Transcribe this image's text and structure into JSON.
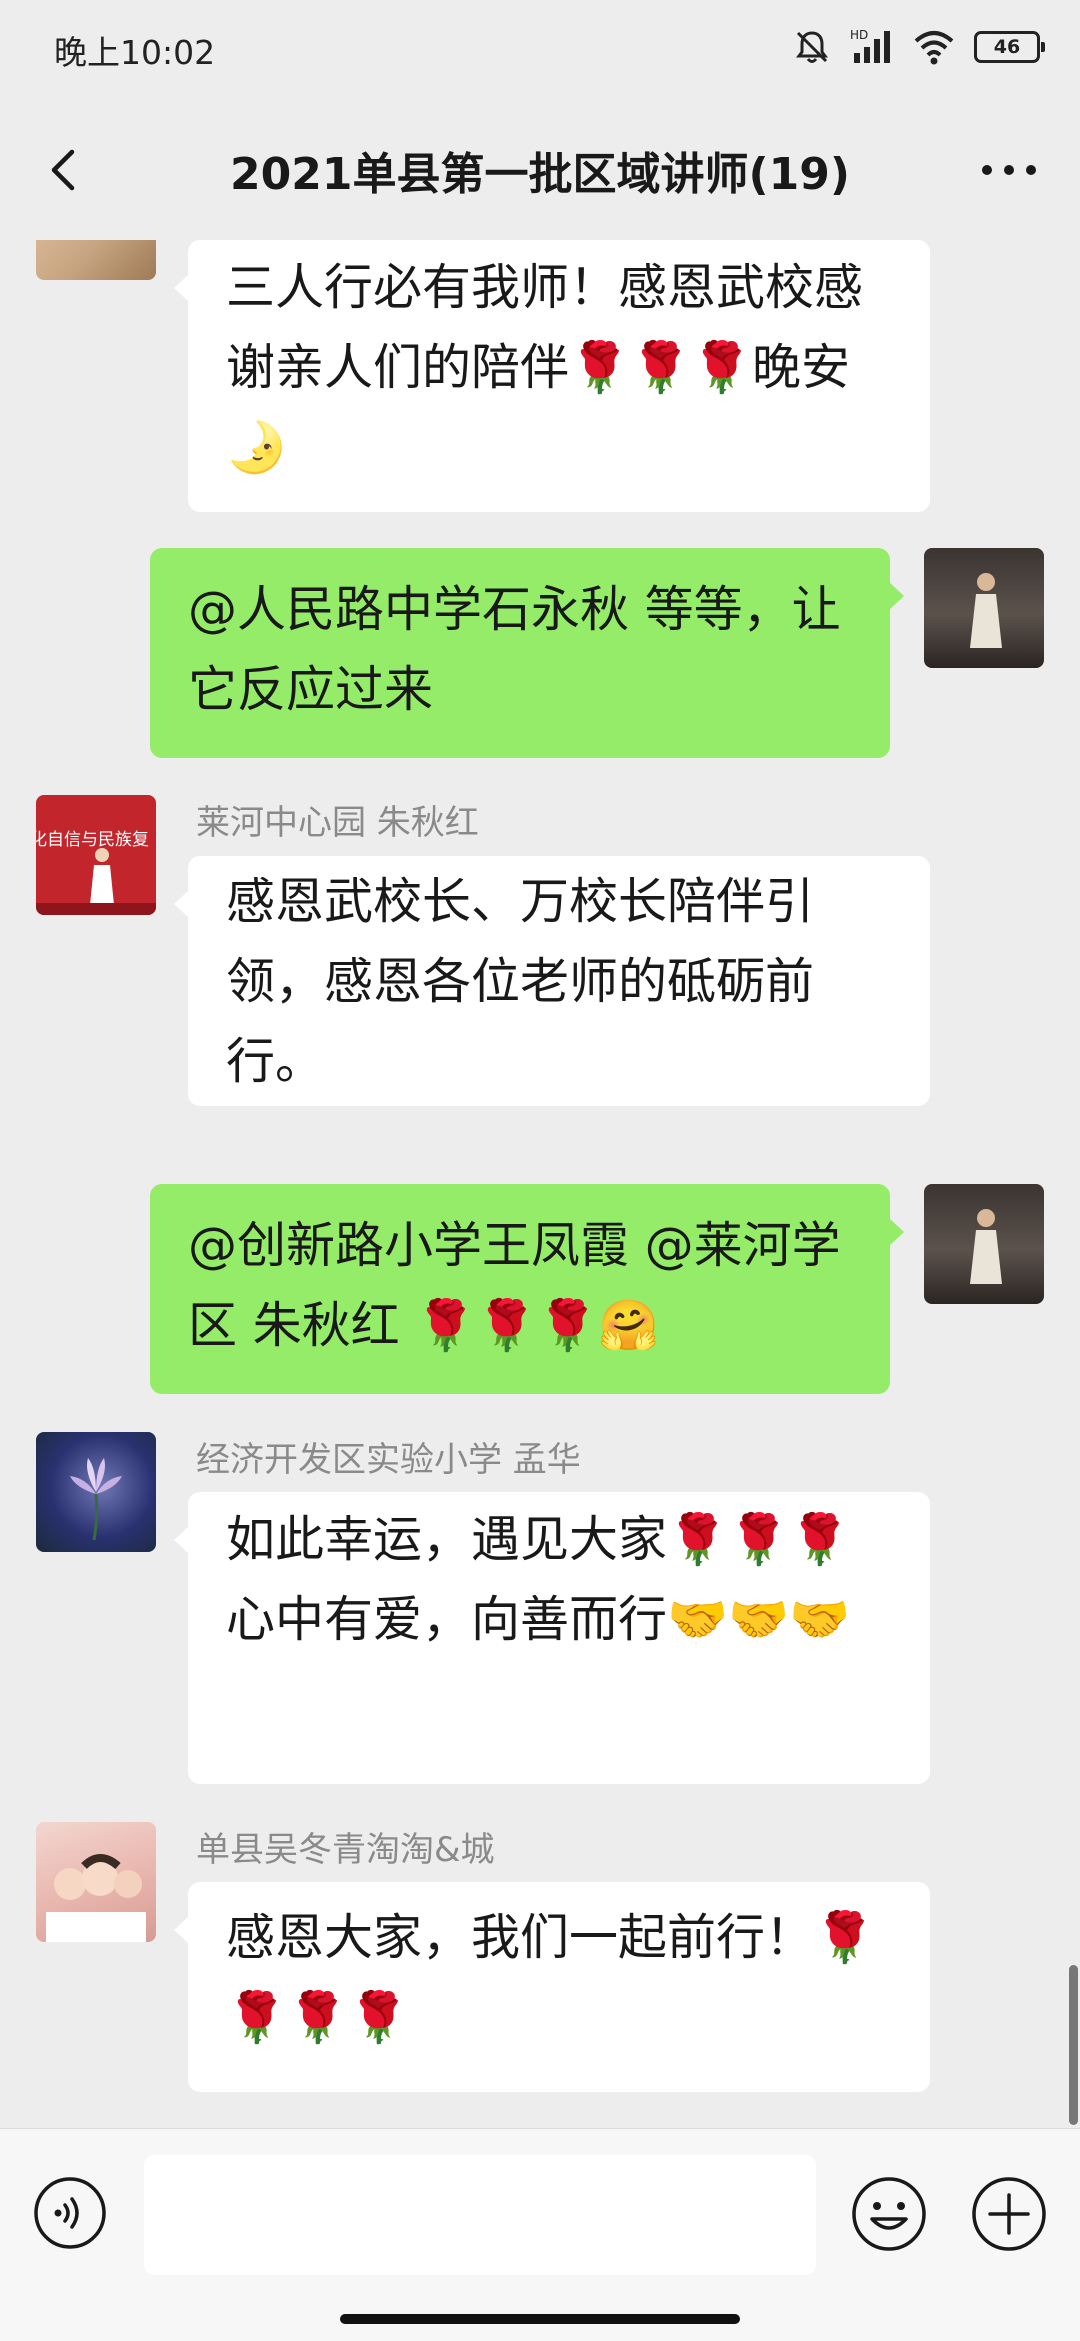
{
  "status_bar": {
    "time": "晚上10:02",
    "hd_label": "HD",
    "battery": "46"
  },
  "header": {
    "title": "2021单县第一批区域讲师(19)"
  },
  "messages": [
    {
      "type": "incoming",
      "sender": "",
      "text": "三人行必有我师！感恩武校感谢亲人们的陪伴🌹🌹🌹晚安🌛"
    },
    {
      "type": "outgoing",
      "text": "@人民路中学石永秋  等等，让它反应过来"
    },
    {
      "type": "incoming",
      "sender": "莱河中心园  朱秋红",
      "avatar_caption": "化自信与民族复",
      "text": "感恩武校长、万校长陪伴引领，感恩各位老师的砥砺前行。"
    },
    {
      "type": "outgoing",
      "text": "@创新路小学王凤霞  @莱河学区  朱秋红 🌹🌹🌹🤗"
    },
    {
      "type": "incoming",
      "sender": "经济开发区实验小学   孟华",
      "text": "如此幸运，遇见大家🌹🌹🌹心中有爱，向善而行🤝🤝🤝"
    },
    {
      "type": "incoming",
      "sender": "单县吴冬青淘淘&城",
      "text": "感恩大家，我们一起前行！🌹🌹🌹🌹"
    }
  ],
  "input": {
    "value": "",
    "placeholder": ""
  },
  "colors": {
    "background": "#ededed",
    "outgoing_bubble": "#95ec69",
    "incoming_bubble": "#ffffff",
    "sender_name": "#8a8a8a"
  }
}
